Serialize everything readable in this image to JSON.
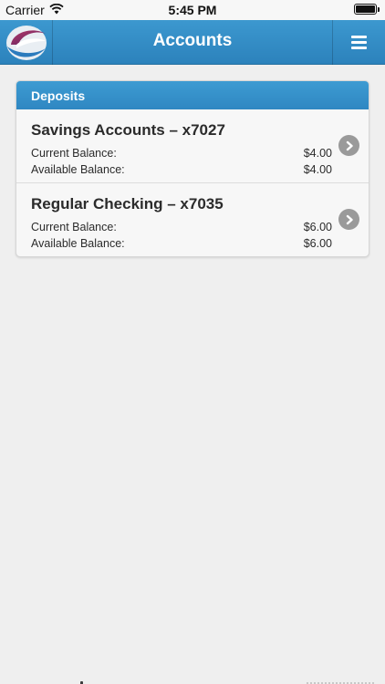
{
  "status_bar": {
    "carrier": "Carrier",
    "time": "5:45 PM"
  },
  "nav": {
    "title": "Accounts",
    "logo_icon": "company-logo-icon",
    "menu_icon": "hamburger-menu-icon"
  },
  "deposits": {
    "header": "Deposits",
    "accounts": [
      {
        "name": "Savings Accounts – x7027",
        "current_label": "Current Balance:",
        "current_value": "$4.00",
        "available_label": "Available Balance:",
        "available_value": "$4.00"
      },
      {
        "name": "Regular Checking – x7035",
        "current_label": "Current Balance:",
        "current_value": "$6.00",
        "available_label": "Available Balance:",
        "available_value": "$6.00"
      }
    ]
  },
  "colors": {
    "accent": "#2f87c2",
    "background": "#efefef",
    "chevron": "#9a9a9a"
  }
}
